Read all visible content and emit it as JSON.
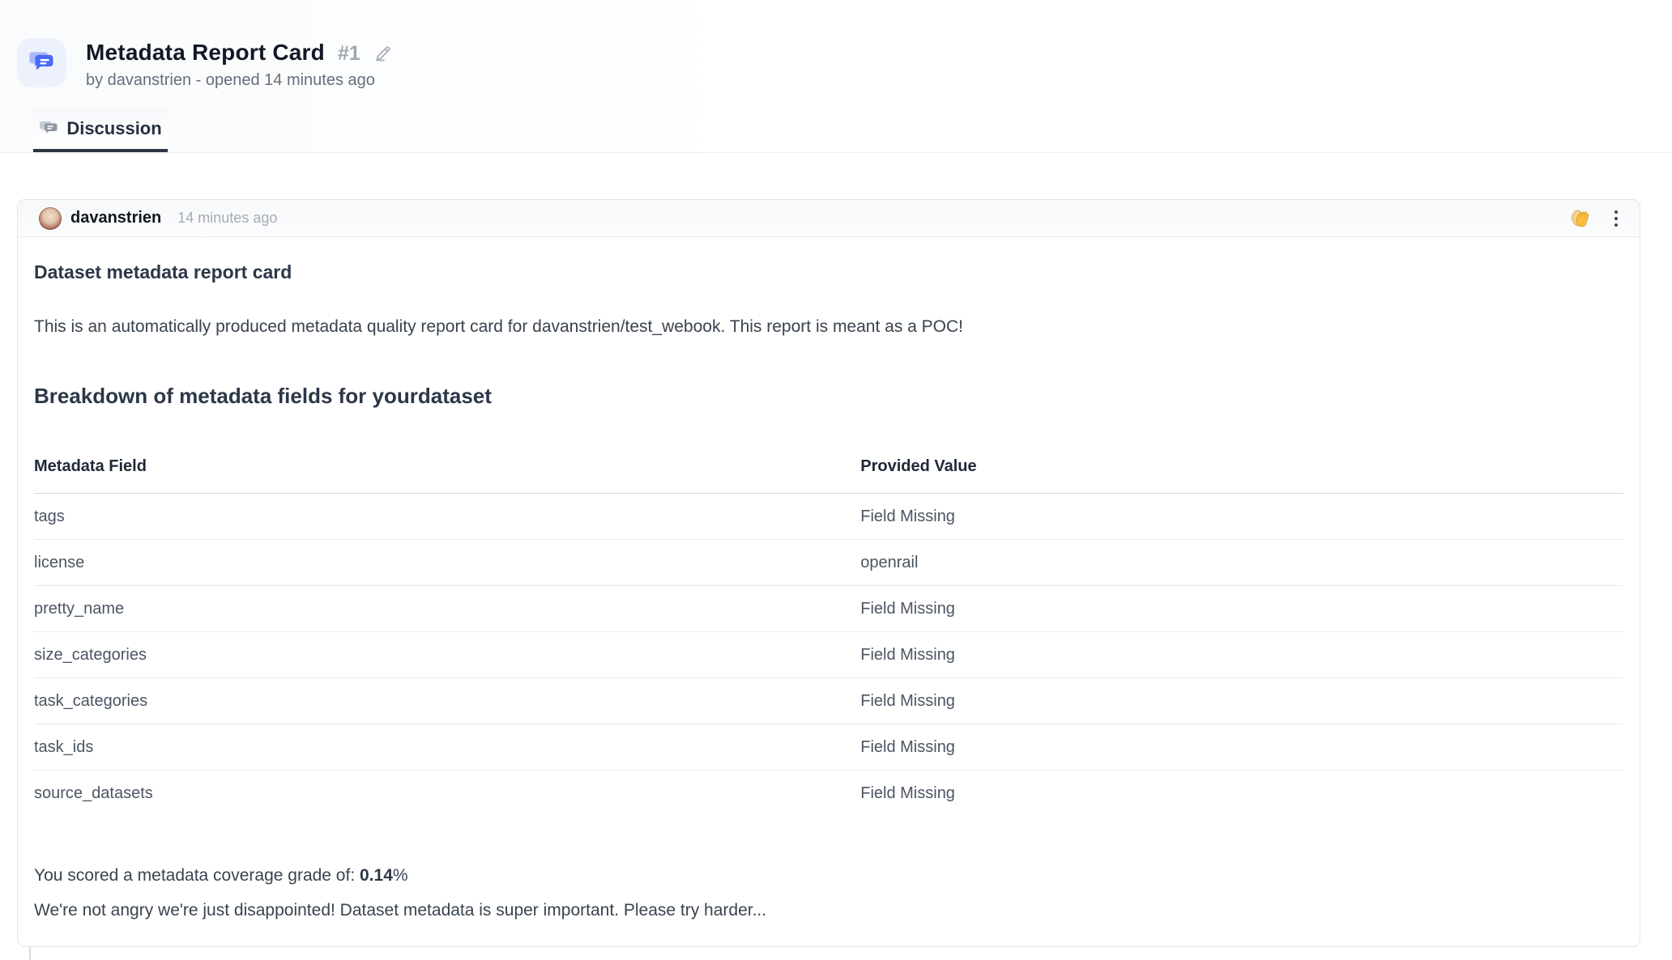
{
  "header": {
    "title": "Metadata Report Card",
    "issue_number": "#1",
    "byline": "by davanstrien - opened 14 minutes ago",
    "icon": "chat-bubbles-icon",
    "edit_icon": "pencil-icon"
  },
  "tabs": [
    {
      "label": "Discussion",
      "icon": "discussion-chat-icon",
      "active": true
    }
  ],
  "comment": {
    "author": "davanstrien",
    "timestamp": "14 minutes ago",
    "reaction_icon": "clapping-hands-emoji",
    "menu_icon": "kebab-menu-icon",
    "body": {
      "heading": "Dataset metadata report card",
      "intro": "This is an automatically produced metadata quality report card for davanstrien/test_webook. This report is meant as a POC!",
      "section_heading": "Breakdown of metadata fields for yourdataset",
      "table": {
        "columns": [
          "Metadata Field",
          "Provided Value"
        ],
        "rows": [
          [
            "tags",
            "Field Missing"
          ],
          [
            "license",
            "openrail"
          ],
          [
            "pretty_name",
            "Field Missing"
          ],
          [
            "size_categories",
            "Field Missing"
          ],
          [
            "task_categories",
            "Field Missing"
          ],
          [
            "task_ids",
            "Field Missing"
          ],
          [
            "source_datasets",
            "Field Missing"
          ]
        ]
      },
      "score_prefix": "You scored a metadata coverage grade of: ",
      "score_value": "0.14",
      "score_suffix": "%",
      "closing": "We're not angry we're just disappointed! Dataset metadata is super important. Please try harder..."
    }
  },
  "colors": {
    "accent_blue": "#4a68f9",
    "light_blue_bg": "#edf1fc",
    "tab_underline": "#2b3544",
    "card_border": "#e2e5e9",
    "muted_text": "#a0a7b1",
    "body_text": "#39434f"
  }
}
